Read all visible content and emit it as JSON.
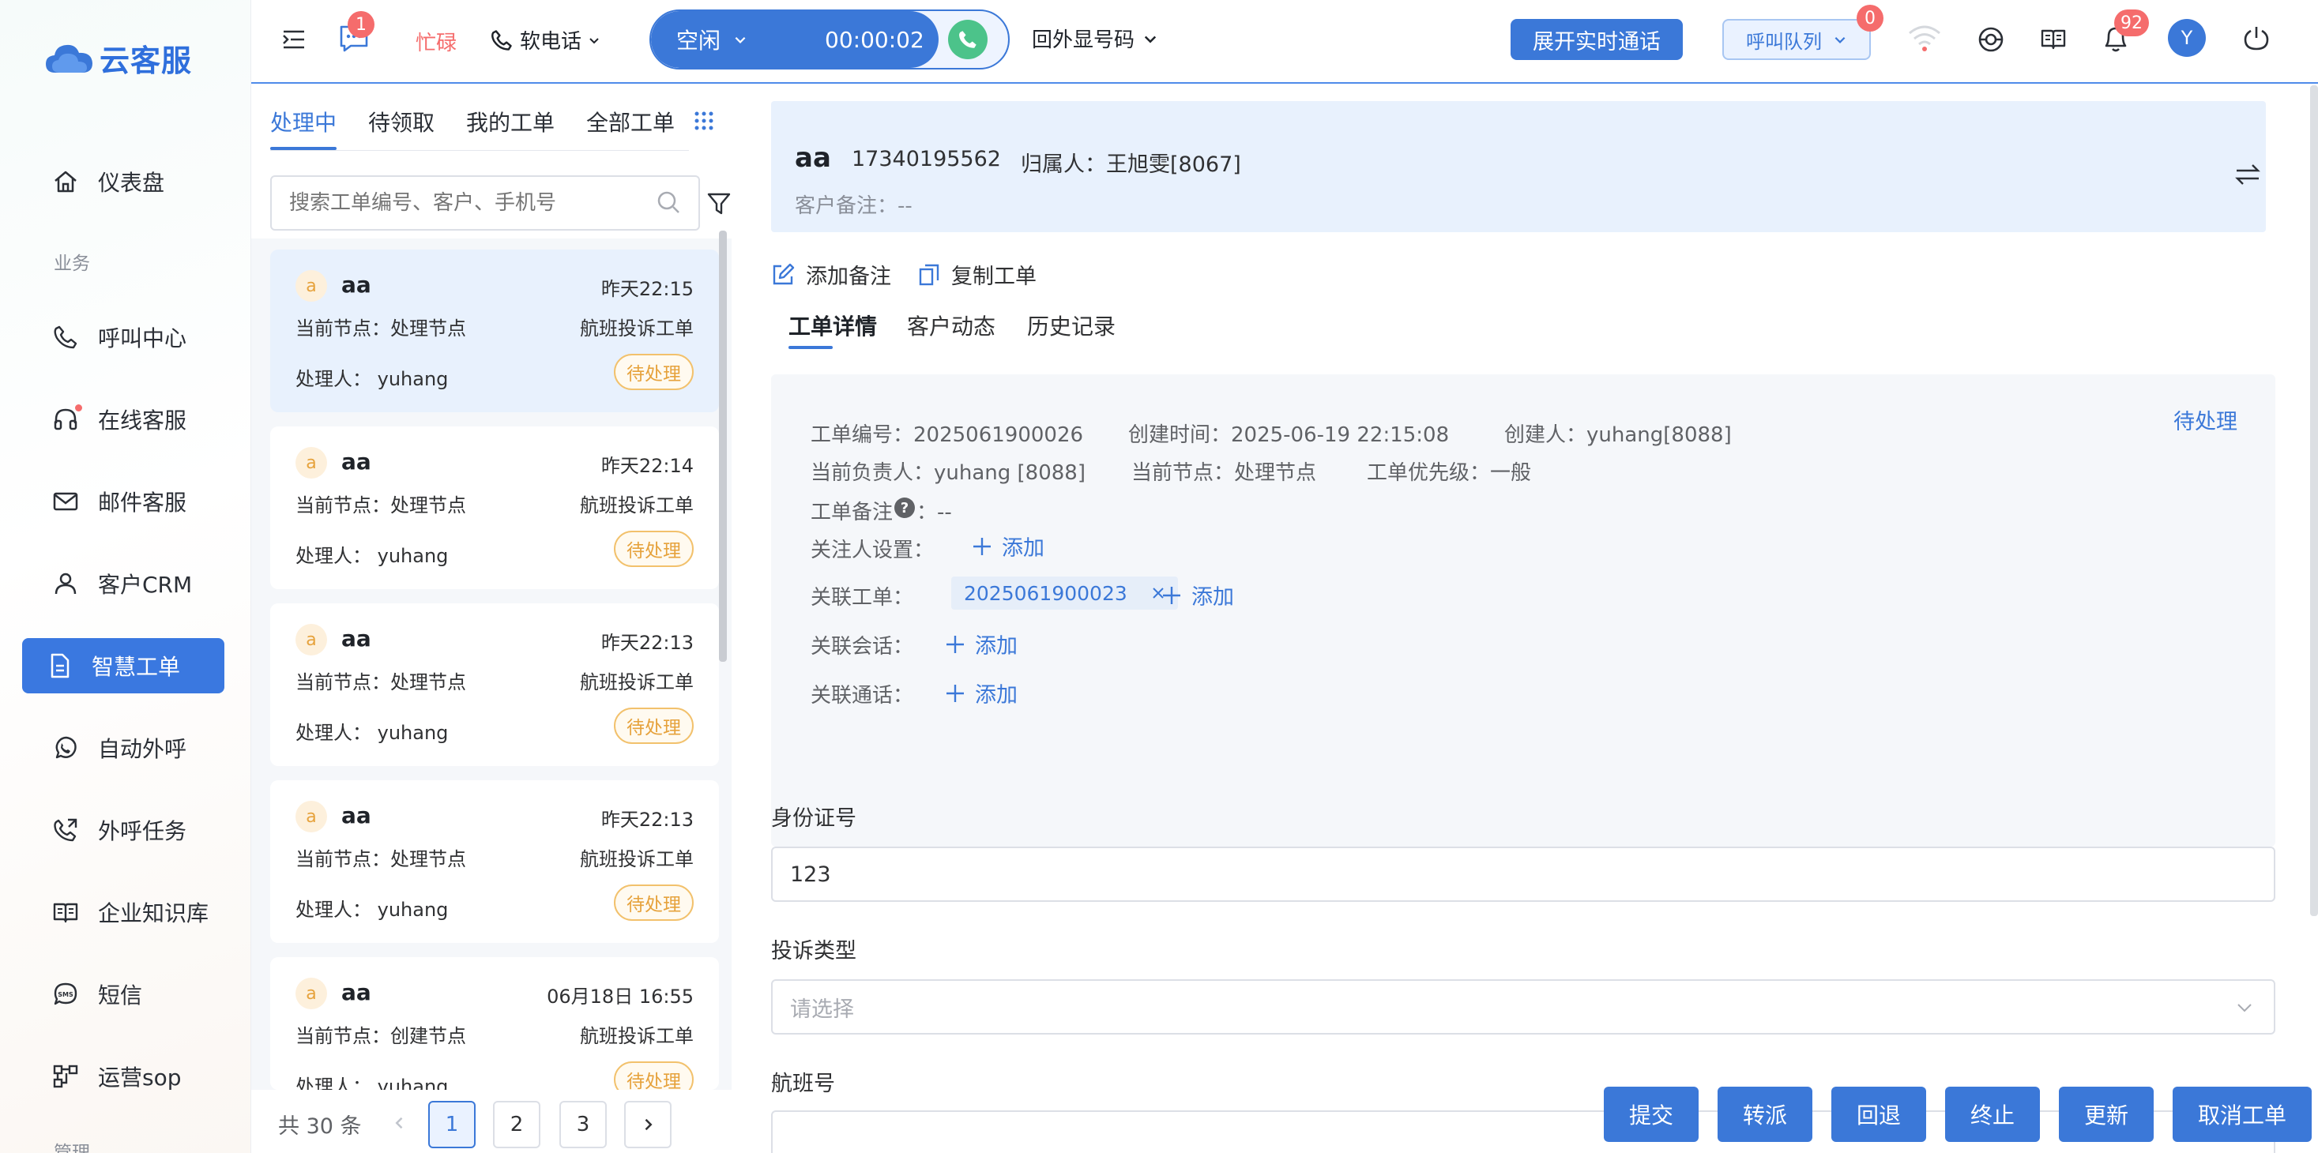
{
  "brand": {
    "name": "云客服",
    "color": "#2f6fdc"
  },
  "sidebar": {
    "section_business": "业务",
    "section_manage": "管理",
    "items": [
      {
        "label": "仪表盘",
        "icon": "home-icon"
      },
      {
        "label": "呼叫中心",
        "icon": "phone-icon"
      },
      {
        "label": "在线客服",
        "icon": "headset-icon"
      },
      {
        "label": "邮件客服",
        "icon": "mail-icon"
      },
      {
        "label": "客户CRM",
        "icon": "user-icon"
      },
      {
        "label": "智慧工单",
        "icon": "document-icon",
        "active": true
      },
      {
        "label": "自动外呼",
        "icon": "whatsapp-phone-icon"
      },
      {
        "label": "外呼任务",
        "icon": "outbound-call-icon"
      },
      {
        "label": "企业知识库",
        "icon": "book-icon"
      },
      {
        "label": "短信",
        "icon": "sms-icon"
      },
      {
        "label": "运营sop",
        "icon": "flow-icon"
      }
    ]
  },
  "topbar": {
    "chat_badge": "1",
    "busy_label": "忙碌",
    "softphone_label": "软电话",
    "status_label": "空闲",
    "call_timer": "00:00:02",
    "outbound_number_label": "回外显号码",
    "expand_call_button": "展开实时通话",
    "queue_button": "呼叫队列",
    "queue_badge": "0",
    "notification_badge": "92",
    "avatar_letter": "Y",
    "accent_color": "#3b78d8"
  },
  "ticket_list": {
    "tabs": [
      "处理中",
      "待领取",
      "我的工单",
      "全部工单"
    ],
    "active_tab": "处理中",
    "search_placeholder": "搜索工单编号、客户、手机号",
    "cards": [
      {
        "avatar": "a",
        "name": "aa",
        "time": "昨天22:15",
        "node": "当前节点：处理节点",
        "type": "航班投诉工单",
        "handler": "处理人： yuhang",
        "status": "待处理"
      },
      {
        "avatar": "a",
        "name": "aa",
        "time": "昨天22:14",
        "node": "当前节点：处理节点",
        "type": "航班投诉工单",
        "handler": "处理人： yuhang",
        "status": "待处理"
      },
      {
        "avatar": "a",
        "name": "aa",
        "time": "昨天22:13",
        "node": "当前节点：处理节点",
        "type": "航班投诉工单",
        "handler": "处理人： yuhang",
        "status": "待处理"
      },
      {
        "avatar": "a",
        "name": "aa",
        "time": "昨天22:13",
        "node": "当前节点：处理节点",
        "type": "航班投诉工单",
        "handler": "处理人： yuhang",
        "status": "待处理"
      },
      {
        "avatar": "a",
        "name": "aa",
        "time": "06月18日 16:55",
        "node": "当前节点：创建节点",
        "type": "航班投诉工单",
        "handler": "处理人： yuhang",
        "status": "待处理"
      }
    ],
    "pager": {
      "total": "共 30 条",
      "pages": [
        "1",
        "2",
        "3"
      ],
      "current": "1"
    }
  },
  "customer": {
    "name": "aa",
    "phone": "17340195562",
    "owner": "归属人：王旭雯[8067]",
    "remark": "客户备注：--"
  },
  "detail": {
    "add_note": "添加备注",
    "copy_ticket": "复制工单",
    "tabs": [
      "工单详情",
      "客户动态",
      "历史记录"
    ],
    "active_tab": "工单详情",
    "status": "待处理",
    "ticket_no": "工单编号：2025061900026",
    "created_at": "创建时间：2025-06-19 22:15:08",
    "creator": "创建人：yuhang[8088]",
    "assignee": "当前负责人：yuhang [8088]",
    "current_node": "当前节点：处理节点",
    "priority": "工单优先级：一般",
    "ticket_remark_label": "工单备注",
    "ticket_remark_value": "：--",
    "watcher_label": "关注人设置：",
    "related_ticket_label": "关联工单：",
    "related_ticket_value": "2025061900023",
    "related_session_label": "关联会话：",
    "related_call_label": "关联通话：",
    "add_label": "添加"
  },
  "form": {
    "id_label": "身份证号",
    "id_value": "123",
    "complaint_label": "投诉类型",
    "complaint_placeholder": "请选择",
    "flight_label": "航班号"
  },
  "actions": [
    "提交",
    "转派",
    "回退",
    "终止",
    "更新",
    "取消工单"
  ]
}
